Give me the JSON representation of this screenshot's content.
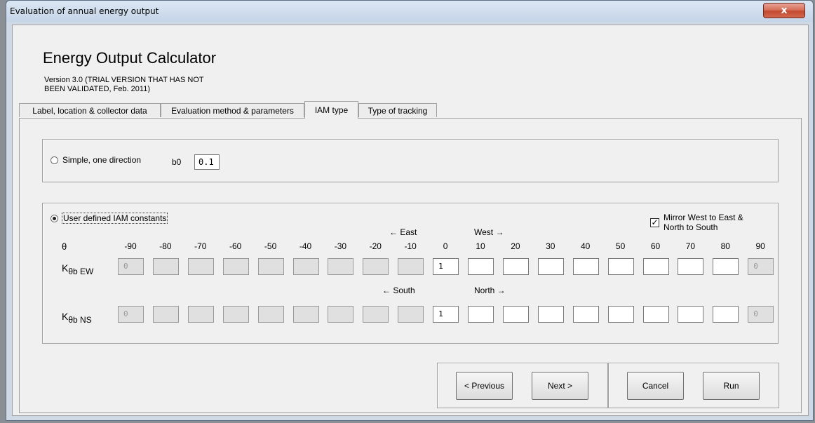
{
  "window": {
    "title": "Evaluation of annual energy output",
    "close_label": "x"
  },
  "app": {
    "title": "Energy Output Calculator",
    "version": "Version 3.0 (TRIAL VERSION THAT HAS NOT BEEN VALIDATED, Feb. 2011)"
  },
  "tabs": [
    {
      "label": "Label, location & collector data",
      "active": false
    },
    {
      "label": "Evaluation method & parameters",
      "active": false
    },
    {
      "label": "IAM type",
      "active": true
    },
    {
      "label": "Type of tracking",
      "active": false
    }
  ],
  "simple": {
    "label": "Simple, one direction",
    "selected": false,
    "b0_label": "b0",
    "b0_value": "0.1"
  },
  "user_defined": {
    "label": "User defined IAM constants",
    "selected": true,
    "mirror_label_line1": "Mirror West to East &",
    "mirror_label_line2": "North to South",
    "mirror_checked": true,
    "theta_symbol": "θ",
    "east_label": "← East",
    "west_label": "West →",
    "south_label": "← South",
    "north_label": "North →",
    "angles": [
      "-90",
      "-80",
      "-70",
      "-60",
      "-50",
      "-40",
      "-30",
      "-20",
      "-10",
      "0",
      "10",
      "20",
      "30",
      "40",
      "50",
      "60",
      "70",
      "80",
      "90"
    ],
    "k_ew_label": "K",
    "k_ew_sub": "θb EW",
    "k_ns_label": "K",
    "k_ns_sub": "θb NS",
    "ew_values": [
      "0",
      "",
      "",
      "",
      "",
      "",
      "",
      "",
      "",
      "1",
      "",
      "",
      "",
      "",
      "",
      "",
      "",
      "",
      "0"
    ],
    "ns_values": [
      "0",
      "",
      "",
      "",
      "",
      "",
      "",
      "",
      "",
      "1",
      "",
      "",
      "",
      "",
      "",
      "",
      "",
      "",
      "0"
    ]
  },
  "buttons": {
    "previous": "< Previous",
    "next": "Next >",
    "cancel": "Cancel",
    "run": "Run"
  }
}
